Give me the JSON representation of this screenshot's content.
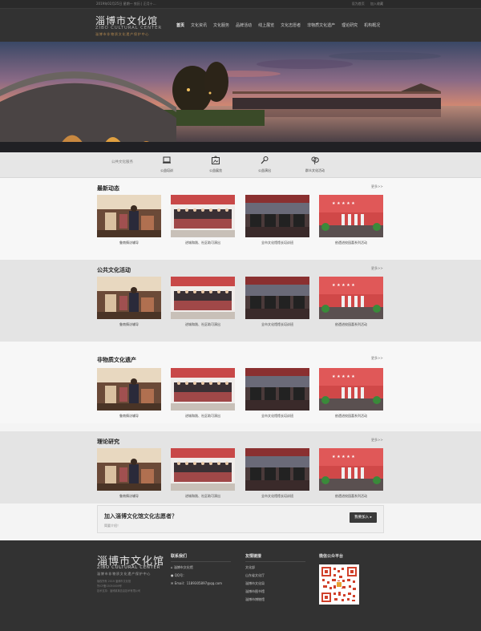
{
  "topbar": {
    "date": "2019年02月25日 星期一 农历 | 正月十...",
    "links": [
      "设为首页",
      "加入收藏"
    ]
  },
  "header": {
    "logo_cn": "淄博市文化馆",
    "logo_en": "ZIBO CULTURAL CENTER",
    "logo_sub": "淄博市非物质文化遗产保护中心",
    "nav": [
      "首页",
      "文化资讯",
      "文化服务",
      "品牌活动",
      "线上展览",
      "文化志愿者",
      "非物质文化遗产",
      "理论研究",
      "机构概况"
    ]
  },
  "services": {
    "label": "公共文化服务",
    "items": [
      {
        "label": "公益培训",
        "icon": "laptop-icon"
      },
      {
        "label": "公益展览",
        "icon": "frame-icon"
      },
      {
        "label": "公益演出",
        "icon": "microphone-icon"
      },
      {
        "label": "群众文化活动",
        "icon": "people-icon"
      }
    ]
  },
  "sections": [
    {
      "title": "最新动态",
      "more": "更多>>",
      "captions": [
        "鲁南情访辅导",
        "进城和践、社区助可演出",
        "全市文化馆馆长培训班",
        "依遗进校园喜系列活动"
      ]
    },
    {
      "title": "公共文化活动",
      "more": "更多>>",
      "captions": [
        "鲁南情访辅导",
        "进城和践、社区助可演出",
        "全市文化馆馆长培训班",
        "依遗进校园喜系列活动"
      ]
    },
    {
      "title": "非物质文化遗产",
      "more": "更多>>",
      "captions": [
        "鲁南情访辅导",
        "进城和践、社区助可演出",
        "全市文化馆馆长培训班",
        "依遗进校园喜系列活动"
      ]
    },
    {
      "title": "理论研究",
      "more": "更多>>",
      "captions": [
        "鲁南情访辅导",
        "进城和践、社区助可演出",
        "全市文化馆馆长培训班",
        "依遗进校园喜系列活动"
      ]
    }
  ],
  "volunteer": {
    "title": "加入淄博文化馆文化志愿者？",
    "subtitle": "简要介绍！",
    "button": "我要加入 ▸"
  },
  "footer": {
    "logo_cn": "淄博市文化馆",
    "logo_en": "ZIBO CULTURAL CENTER",
    "logo_sub": "淄博市非物质文化遗产保护中心",
    "copyright": [
      "版权所有 2019 淄博市文化馆",
      "鲁ICP备15050009号",
      "技术支持：淄博某某信息技术有限公司"
    ],
    "contact_title": "联系我们",
    "contact": [
      "淄博市文化馆",
      "QQ号：",
      "Email：1189305897@qq.com"
    ],
    "links_title": "友情链接",
    "links": [
      "文化部",
      "山东省文化厅",
      "淄博市文化局",
      "淄博市图书馆",
      "淄博市博物馆"
    ],
    "wechat_title": "微信公众平台"
  },
  "colors": {
    "header_bg": "#323232",
    "accent_gold": "#b58a50",
    "section_gray": "#e4e4e4"
  }
}
